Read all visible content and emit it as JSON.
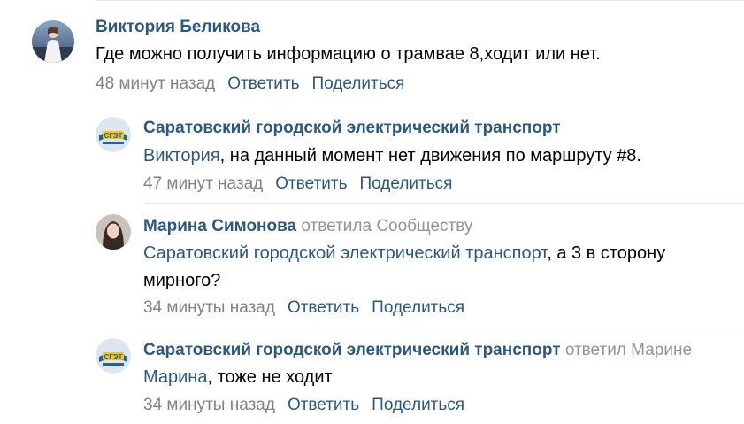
{
  "comments": [
    {
      "author": "Виктория Беликова",
      "text": "Где можно получить информацию о трамвае 8,ходит или нет.",
      "time": "48 минут назад",
      "reply": "Ответить",
      "share": "Поделиться"
    },
    {
      "author": "Саратовский городской электрический транспорт",
      "mention": "Виктория",
      "text": ", на данный момент нет движения по маршруту #8.",
      "time": "47 минут назад",
      "reply": "Ответить",
      "share": "Поделиться"
    },
    {
      "author": "Марина Симонова",
      "reply_to": "ответила Сообществу",
      "mention": "Саратовский городской электрический транспорт",
      "text": ", а 3 в сторону",
      "text_line2": "мирного?",
      "time": "34 минуты назад",
      "reply": "Ответить",
      "share": "Поделиться"
    },
    {
      "author": "Саратовский городской электрический транспорт",
      "reply_to": "ответил Марине",
      "mention": "Марина",
      "text": ", тоже не ходит",
      "time": "34 минуты назад",
      "reply": "Ответить",
      "share": "Поделиться"
    }
  ],
  "colors": {
    "link": "#2a5885",
    "meta": "#828282",
    "reply_to": "#939393",
    "divider": "#e7e8ec"
  },
  "icons": [
    "user-avatar-photo",
    "community-logo-sget",
    "user-avatar-photo"
  ]
}
